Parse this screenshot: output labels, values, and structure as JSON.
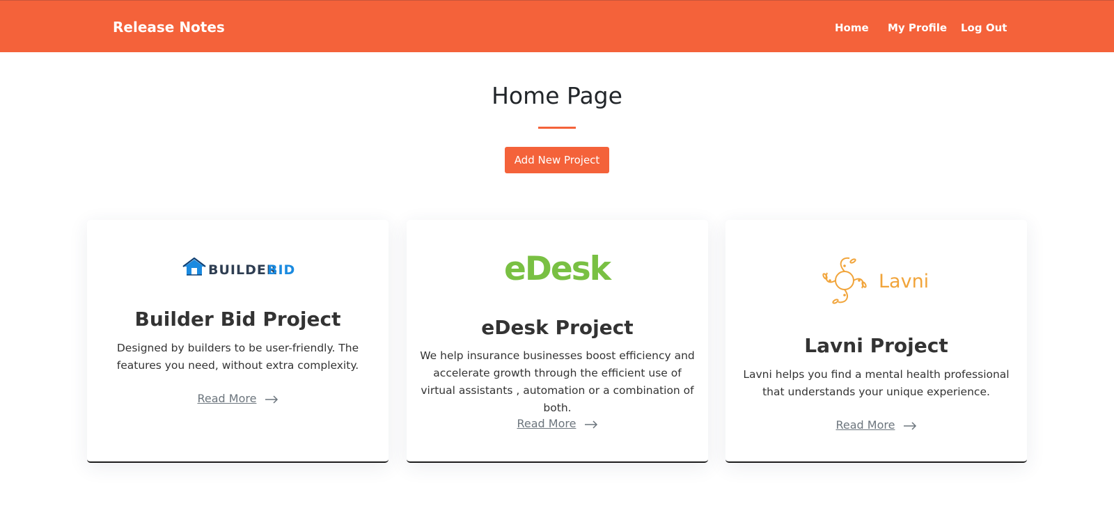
{
  "nav": {
    "brand": "Release Notes",
    "links": [
      "Home",
      "My Profile",
      "Log Out"
    ],
    "background": "#f4623a"
  },
  "main": {
    "title": "Home Page",
    "add_button": "Add New Project",
    "accent": "#f4623a"
  },
  "cards": [
    {
      "logo": {
        "word_dark": "BUILDER",
        "word_accent": "BID",
        "icon": "house-logo-icon",
        "accent_color": "#1a8ae0"
      },
      "title": "Builder Bid Project",
      "description": "Designed by builders to be user-friendly. The features you need, without extra complexity.",
      "link": "Read More"
    },
    {
      "logo": {
        "word": "eDesk",
        "color": "#79c043"
      },
      "title": "eDesk Project",
      "description": "We help insurance businesses boost efficiency and accelerate growth through the efficient use of virtual assistants , automation or a combination of both.",
      "link": "Read More"
    },
    {
      "logo": {
        "word": "Lavni",
        "icon": "leaf-swirl-logo-icon",
        "color": "#f1a43a"
      },
      "title": "Lavni Project",
      "description": "Lavni helps you find a mental health professional that understands your unique experience.",
      "link": "Read More"
    }
  ]
}
